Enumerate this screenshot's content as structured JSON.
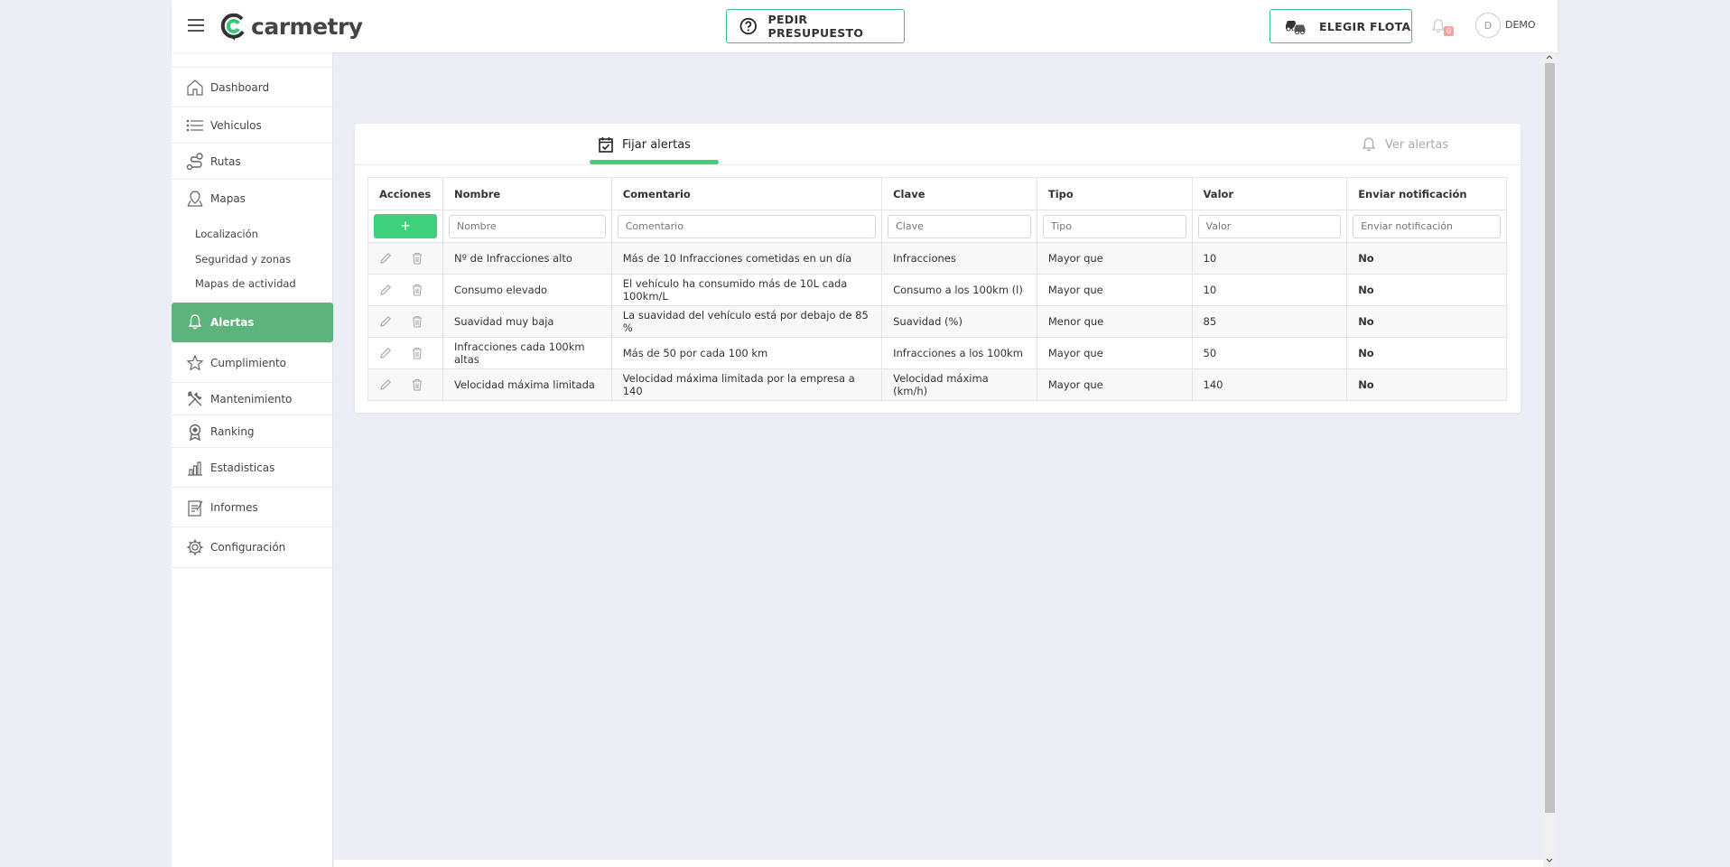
{
  "header": {
    "brand": "carmetry",
    "quote_button": "PEDIR PRESUPUESTO",
    "fleet_button": "ELEGIR FLOTA",
    "notification_count": "0",
    "avatar_initial": "D",
    "user_name": "DEMO"
  },
  "sidebar": {
    "items": [
      {
        "label": "Dashboard"
      },
      {
        "label": "Vehiculos"
      },
      {
        "label": "Rutas"
      },
      {
        "label": "Mapas"
      },
      {
        "label": "Alertas"
      },
      {
        "label": "Cumplimiento"
      },
      {
        "label": "Mantenimiento"
      },
      {
        "label": "Ranking"
      },
      {
        "label": "Estadisticas"
      },
      {
        "label": "Informes"
      },
      {
        "label": "Configuración"
      }
    ],
    "subitems": [
      {
        "label": "Localización"
      },
      {
        "label": "Seguridad y zonas"
      },
      {
        "label": "Mapas de actividad"
      }
    ],
    "active": "Alertas"
  },
  "tabs": {
    "set_alerts": "Fijar alertas",
    "view_alerts": "Ver alertas"
  },
  "table": {
    "columns": [
      "Acciones",
      "Nombre",
      "Comentario",
      "Clave",
      "Tipo",
      "Valor",
      "Enviar notificación"
    ],
    "add_label": "+",
    "filters": {
      "nombre": "Nombre",
      "comentario": "Comentario",
      "clave": "Clave",
      "tipo": "Tipo",
      "valor": "Valor",
      "notificacion": "Enviar notificación"
    },
    "rows": [
      {
        "nombre": "Nº de Infracciones alto",
        "comentario": "Más de 10 Infracciones cometidas en un día",
        "clave": "Infracciones",
        "tipo": "Mayor que",
        "valor": "10",
        "notificacion": "No"
      },
      {
        "nombre": "Consumo elevado",
        "comentario": "El vehículo ha consumido más de 10L cada 100km/L",
        "clave": "Consumo a los 100km (l)",
        "tipo": "Mayor que",
        "valor": "10",
        "notificacion": "No"
      },
      {
        "nombre": "Suavidad muy baja",
        "comentario": "La suavidad del vehículo está por debajo de 85 %",
        "clave": "Suavidad (%)",
        "tipo": "Menor que",
        "valor": "85",
        "notificacion": "No"
      },
      {
        "nombre": "Infracciones cada 100km altas",
        "comentario": "Más de 50 por cada 100 km",
        "clave": "Infracciones a los 100km",
        "tipo": "Mayor que",
        "valor": "50",
        "notificacion": "No"
      },
      {
        "nombre": "Velocidad máxima limitada",
        "comentario": "Velocidad máxima limitada por la empresa a 140",
        "clave": "Velocidad máxima (km/h)",
        "tipo": "Mayor que",
        "valor": "140",
        "notificacion": "No"
      }
    ]
  },
  "colors": {
    "accent": "#3ed07b",
    "sidebar_active": "#5cb47c",
    "negative": "#e00000"
  }
}
